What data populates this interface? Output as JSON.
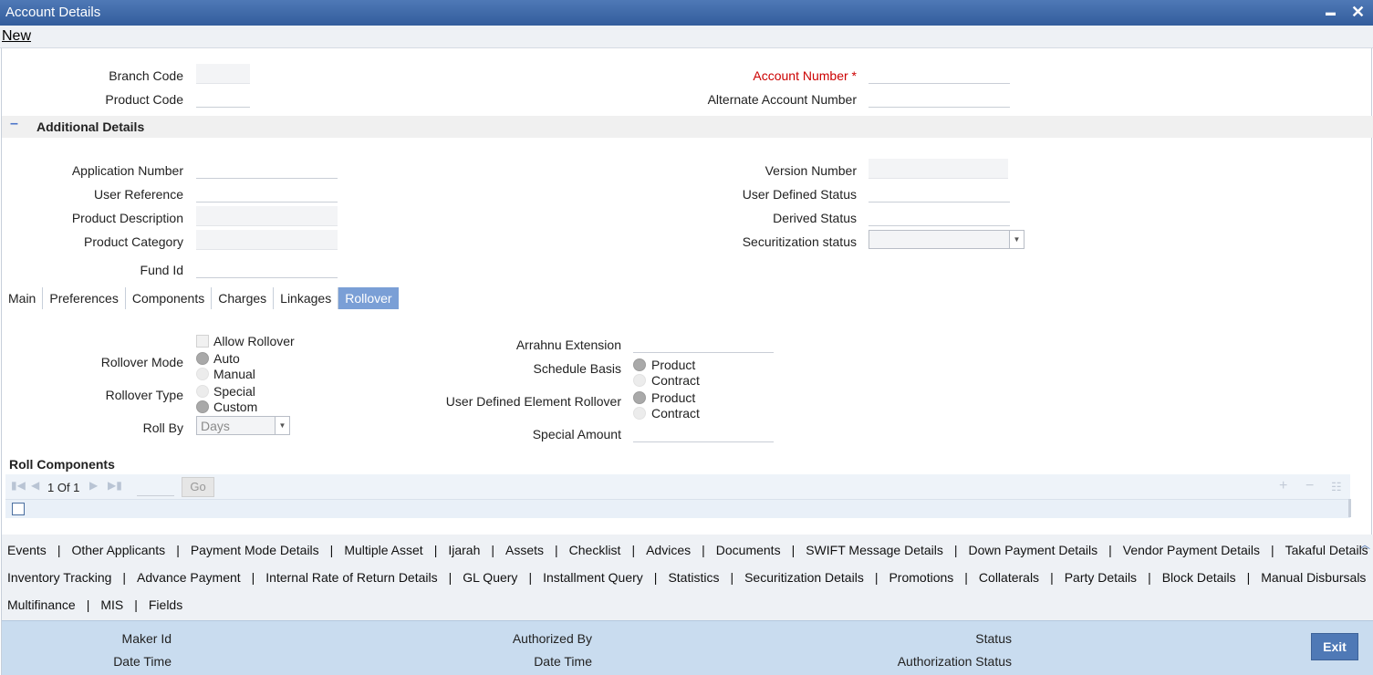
{
  "window": {
    "title": "Account Details",
    "minimize": "▬",
    "close": "✕"
  },
  "menu": {
    "new": "New"
  },
  "header_fields": {
    "branch_code": "Branch Code",
    "product_code": "Product Code",
    "account_number": "Account Number",
    "required_marker": "*",
    "alternate_account_number": "Alternate Account Number"
  },
  "additional": {
    "toggle": "–",
    "title": "Additional Details",
    "application_number": "Application Number",
    "user_reference": "User Reference",
    "product_description": "Product Description",
    "product_category": "Product Category",
    "fund_id": "Fund Id",
    "version_number": "Version Number",
    "user_defined_status": "User Defined Status",
    "derived_status": "Derived Status",
    "securitization_status": "Securitization status"
  },
  "tabs": [
    "Main",
    "Preferences",
    "Components",
    "Charges",
    "Linkages",
    "Rollover"
  ],
  "active_tab": "Rollover",
  "rollover": {
    "allow_rollover": "Allow Rollover",
    "rollover_mode": "Rollover Mode",
    "mode_auto": "Auto",
    "mode_manual": "Manual",
    "rollover_type": "Rollover Type",
    "type_special": "Special",
    "type_custom": "Custom",
    "roll_by": "Roll By",
    "roll_by_value": "Days",
    "arrahnu_extension": "Arrahnu Extension",
    "schedule_basis": "Schedule Basis",
    "schedule_product": "Product",
    "schedule_contract": "Contract",
    "ude_rollover": "User Defined Element Rollover",
    "ude_product": "Product",
    "ude_contract": "Contract",
    "special_amount": "Special Amount"
  },
  "roll_components": {
    "title": "Roll Components",
    "page_text": "1 Of 1",
    "go": "Go"
  },
  "links": {
    "row1": [
      "Events",
      "Other Applicants",
      "Payment Mode Details",
      "Multiple Asset",
      "Ijarah",
      "Assets",
      "Checklist",
      "Advices",
      "Documents",
      "SWIFT Message Details",
      "Down Payment Details",
      "Vendor Payment Details",
      "Takaful Details"
    ],
    "row2": [
      "Inventory Tracking",
      "Advance Payment",
      "Internal Rate of Return Details",
      "GL Query",
      "Installment Query",
      "Statistics",
      "Securitization Details",
      "Promotions",
      "Collaterals",
      "Party Details",
      "Block Details",
      "Manual Disbursals"
    ],
    "row3": [
      "Multifinance",
      "MIS",
      "Fields"
    ]
  },
  "footer": {
    "maker_id": "Maker Id",
    "date_time": "Date Time",
    "authorized_by": "Authorized By",
    "date_time_2": "Date Time",
    "status": "Status",
    "authorization_status": "Authorization Status",
    "exit": "Exit"
  }
}
